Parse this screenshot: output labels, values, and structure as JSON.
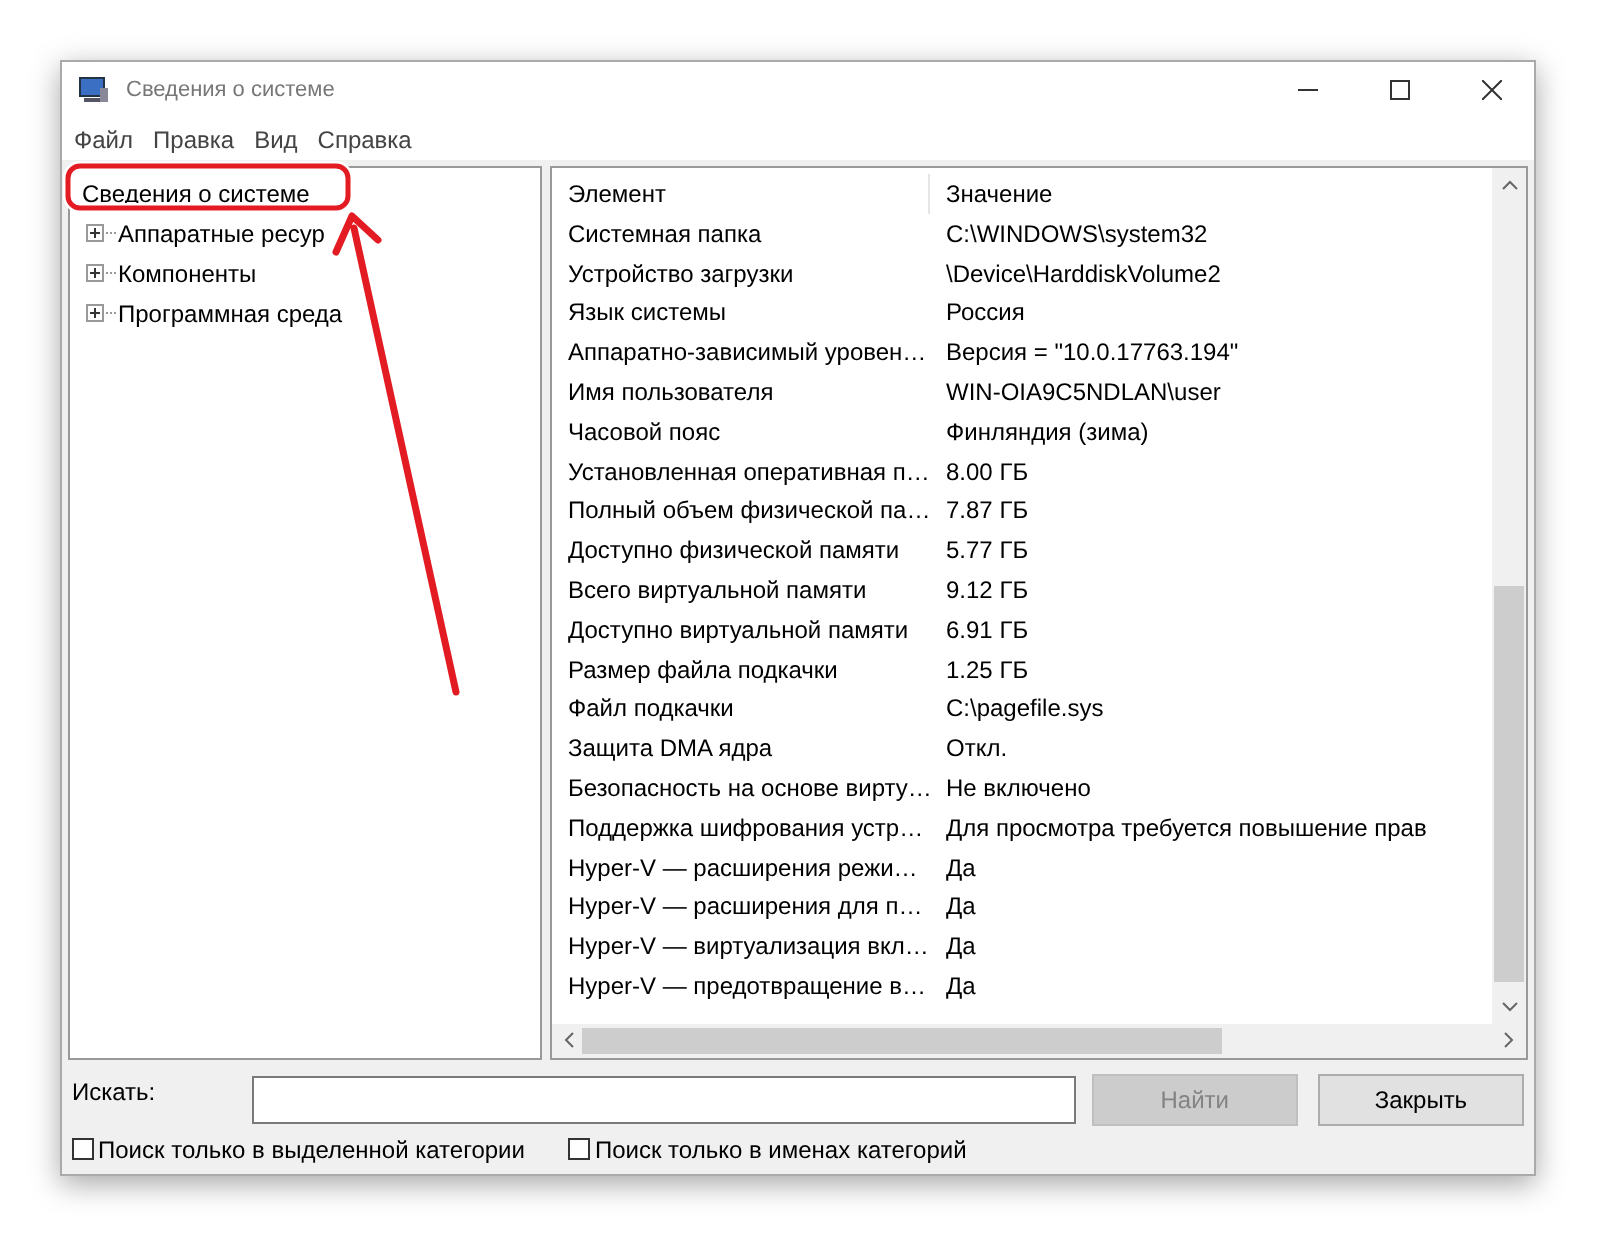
{
  "window": {
    "title": "Сведения о системе"
  },
  "menu": [
    "Файл",
    "Правка",
    "Вид",
    "Справка"
  ],
  "tree": {
    "label": "Сведения о системе",
    "children": [
      {
        "label": "Аппаратные ресур",
        "expanded": false
      },
      {
        "label": "Компоненты",
        "expanded": false
      },
      {
        "label": "Программная среда",
        "expanded": false
      }
    ]
  },
  "table": {
    "columns": [
      "Элемент",
      "Значение"
    ],
    "rows": [
      [
        "Системная папка",
        "C:\\WINDOWS\\system32"
      ],
      [
        "Устройство загрузки",
        "\\Device\\HarddiskVolume2"
      ],
      [
        "Язык системы",
        "Россия"
      ],
      [
        "Аппаратно-зависимый уровен…",
        "Версия = \"10.0.17763.194\""
      ],
      [
        "Имя пользователя",
        "WIN-OIA9C5NDLAN\\user"
      ],
      [
        "Часовой пояс",
        "Финляндия (зима)"
      ],
      [
        "Установленная оперативная п…",
        "8.00 ГБ"
      ],
      [
        "Полный объем физической па…",
        "7.87 ГБ"
      ],
      [
        "Доступно физической памяти",
        "5.77 ГБ"
      ],
      [
        "Всего виртуальной памяти",
        "9.12 ГБ"
      ],
      [
        "Доступно виртуальной памяти",
        "6.91 ГБ"
      ],
      [
        "Размер файла подкачки",
        "1.25 ГБ"
      ],
      [
        "Файл подкачки",
        "C:\\pagefile.sys"
      ],
      [
        "Защита DMA ядра",
        "Откл."
      ],
      [
        "Безопасность на основе вирту…",
        "Не включено"
      ],
      [
        "Поддержка шифрования устр…",
        "Для просмотра требуется повышение прав"
      ],
      [
        "Hyper-V — расширения режи…",
        "Да"
      ],
      [
        "Hyper-V — расширения для п…",
        "Да"
      ],
      [
        "Hyper-V — виртуализация вкл…",
        "Да"
      ],
      [
        "Hyper-V — предотвращение в…",
        "Да"
      ]
    ]
  },
  "search": {
    "label": "Искать:",
    "find_button": {
      "label": "Найти",
      "disabled": true
    },
    "close_button": "Закрыть"
  },
  "options": [
    {
      "label": "Поиск только в выделенной категории",
      "checked": false
    },
    {
      "label": "Поиск только в именах категорий",
      "checked": false
    }
  ]
}
